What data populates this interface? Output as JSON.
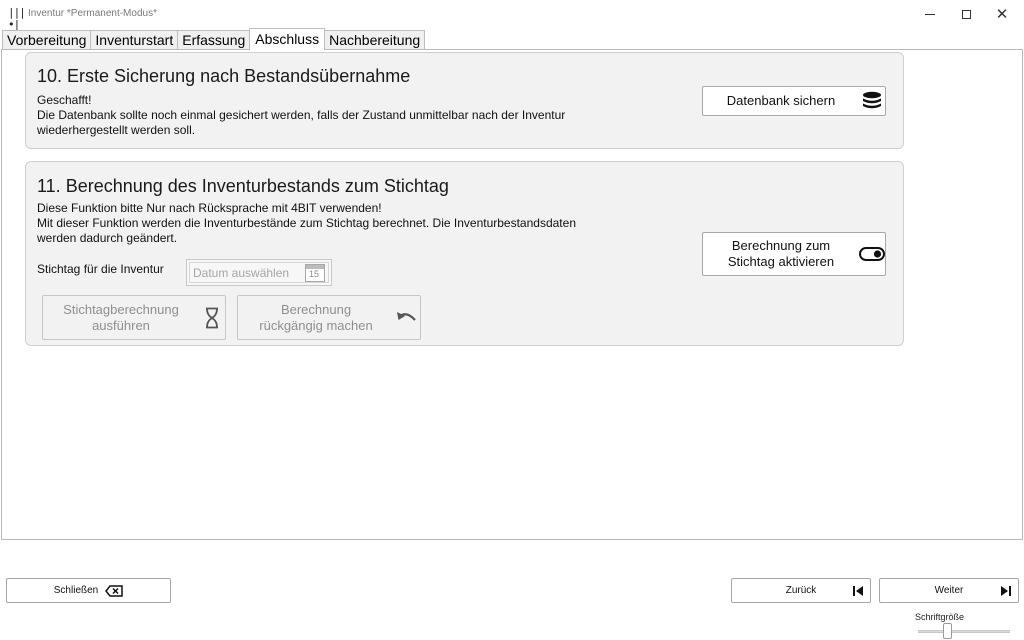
{
  "window": {
    "title": "Inventur *Permanent-Modus*",
    "app_icon": "|||•|"
  },
  "tabs": [
    {
      "label": "Vorbereitung",
      "active": false
    },
    {
      "label": "Inventurstart",
      "active": false
    },
    {
      "label": "Erfassung",
      "active": false
    },
    {
      "label": "Abschluss",
      "active": true
    },
    {
      "label": "Nachbereitung",
      "active": false
    }
  ],
  "section1": {
    "title": "10. Erste Sicherung nach Bestandsübernahme",
    "line1": "Geschafft!",
    "line2": "Die Datenbank sollte noch einmal gesichert werden, falls der Zustand unmittelbar nach der Inventur",
    "line3": "wiederhergestellt werden soll.",
    "button": {
      "label": "Datenbank sichern",
      "icon": "database-icon"
    }
  },
  "section2": {
    "title": "11.  Berechnung des Inventurbestands zum Stichtag",
    "line1": "Diese Funktion bitte Nur nach Rücksprache mit 4BIT verwenden!",
    "line2": "Mit dieser Funktion werden die Inventurbestände zum Stichtag berechnet. Die Inventurbestandsdaten",
    "line3": "werden dadurch geändert.",
    "date_label": "Stichtag für die Inventur",
    "date_placeholder": "Datum auswählen",
    "calendar_day": "15",
    "toggle_button": {
      "line1": "Berechnung zum",
      "line2": "Stichtag aktivieren",
      "icon": "toggle-icon"
    },
    "run_button": {
      "line1": "Stichtagberechnung",
      "line2": "ausführen",
      "icon": "hourglass-icon"
    },
    "undo_button": {
      "line1": "Berechnung",
      "line2": "rückgängig machen",
      "icon": "undo-icon"
    }
  },
  "footer": {
    "close_label": "Schließen",
    "back_label": "Zurück",
    "next_label": "Weiter",
    "font_size_label": "Schriftgröße",
    "font_size_level": 0.3
  },
  "colors": {
    "section_bg": "#f2f2f2",
    "border": "#cfcfcf",
    "disabled_text": "#8f8f8f"
  }
}
